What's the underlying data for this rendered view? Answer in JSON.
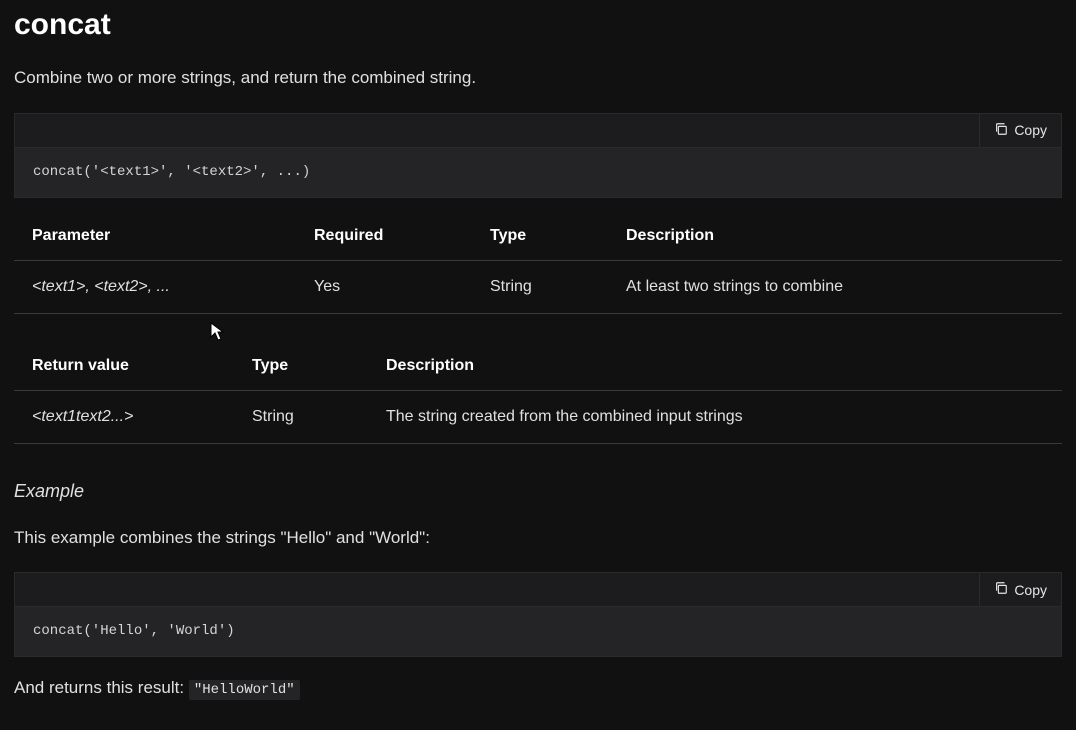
{
  "title": "concat",
  "description": "Combine two or more strings, and return the combined string.",
  "copy_label": "Copy",
  "syntax_code": "concat('<text1>', '<text2>', ...)",
  "params_table": {
    "headers": [
      "Parameter",
      "Required",
      "Type",
      "Description"
    ],
    "row": {
      "param": "<text1>, <text2>, ...",
      "required": "Yes",
      "type": "String",
      "desc": "At least two strings to combine"
    }
  },
  "return_table": {
    "headers": [
      "Return value",
      "Type",
      "Description"
    ],
    "row": {
      "value": "<text1text2...>",
      "type": "String",
      "desc": "The string created from the combined input strings"
    }
  },
  "example_heading": "Example",
  "example_desc": "This example combines the strings \"Hello\" and \"World\":",
  "example_code": "concat('Hello', 'World')",
  "result_prefix": "And returns this result: ",
  "result_value": "\"HelloWorld\""
}
